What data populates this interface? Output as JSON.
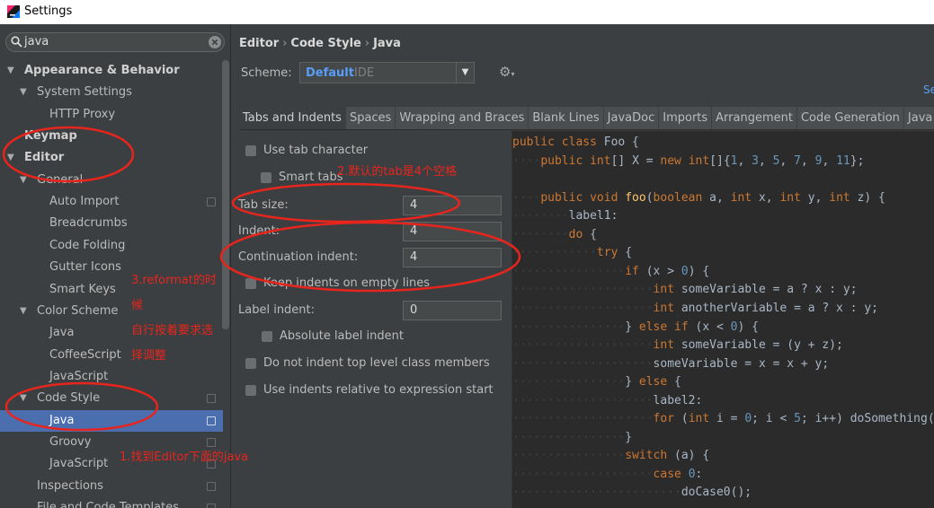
{
  "window": {
    "title": "Settings"
  },
  "search": {
    "value": "java"
  },
  "sidebar": {
    "items": [
      {
        "label": "Appearance & Behavior",
        "level": 0,
        "arrow": "▼",
        "bold": true,
        "selected": false,
        "page_icon": false
      },
      {
        "label": "System Settings",
        "level": 1,
        "arrow": "▼",
        "bold": false,
        "selected": false,
        "page_icon": false
      },
      {
        "label": "HTTP Proxy",
        "level": 2,
        "arrow": "",
        "bold": false,
        "selected": false,
        "page_icon": false
      },
      {
        "label": "Keymap",
        "level": 0,
        "arrow": "",
        "bold": true,
        "selected": false,
        "page_icon": false
      },
      {
        "label": "Editor",
        "level": 0,
        "arrow": "▼",
        "bold": true,
        "selected": false,
        "page_icon": false
      },
      {
        "label": "General",
        "level": 1,
        "arrow": "▼",
        "bold": false,
        "selected": false,
        "page_icon": false
      },
      {
        "label": "Auto Import",
        "level": 2,
        "arrow": "",
        "bold": false,
        "selected": false,
        "page_icon": true
      },
      {
        "label": "Breadcrumbs",
        "level": 2,
        "arrow": "",
        "bold": false,
        "selected": false,
        "page_icon": false
      },
      {
        "label": "Code Folding",
        "level": 2,
        "arrow": "",
        "bold": false,
        "selected": false,
        "page_icon": false
      },
      {
        "label": "Gutter Icons",
        "level": 2,
        "arrow": "",
        "bold": false,
        "selected": false,
        "page_icon": false
      },
      {
        "label": "Smart Keys",
        "level": 2,
        "arrow": "",
        "bold": false,
        "selected": false,
        "page_icon": false
      },
      {
        "label": "Color Scheme",
        "level": 1,
        "arrow": "▼",
        "bold": false,
        "selected": false,
        "page_icon": false
      },
      {
        "label": "Java",
        "level": 2,
        "arrow": "",
        "bold": false,
        "selected": false,
        "page_icon": false
      },
      {
        "label": "CoffeeScript",
        "level": 2,
        "arrow": "",
        "bold": false,
        "selected": false,
        "page_icon": false
      },
      {
        "label": "JavaScript",
        "level": 2,
        "arrow": "",
        "bold": false,
        "selected": false,
        "page_icon": false
      },
      {
        "label": "Code Style",
        "level": 1,
        "arrow": "▼",
        "bold": false,
        "selected": false,
        "page_icon": true
      },
      {
        "label": "Java",
        "level": 2,
        "arrow": "",
        "bold": false,
        "selected": true,
        "page_icon": true
      },
      {
        "label": "Groovy",
        "level": 2,
        "arrow": "",
        "bold": false,
        "selected": false,
        "page_icon": true
      },
      {
        "label": "JavaScript",
        "level": 2,
        "arrow": "",
        "bold": false,
        "selected": false,
        "page_icon": true
      },
      {
        "label": "Inspections",
        "level": 1,
        "arrow": "",
        "bold": false,
        "selected": false,
        "page_icon": true
      },
      {
        "label": "File and Code Templates",
        "level": 1,
        "arrow": "",
        "bold": false,
        "selected": false,
        "page_icon": true
      }
    ]
  },
  "breadcrumb": [
    "Editor",
    "Code Style",
    "Java"
  ],
  "scheme": {
    "label": "Scheme:",
    "value": "Default",
    "kind": "IDE",
    "set_from_link": "Se"
  },
  "tabs": [
    "Tabs and Indents",
    "Spaces",
    "Wrapping and Braces",
    "Blank Lines",
    "JavaDoc",
    "Imports",
    "Arrangement",
    "Code Generation",
    "Java EE Na"
  ],
  "active_tab": 0,
  "options": {
    "use_tab_character": "Use tab character",
    "smart_tabs": "Smart tabs",
    "tab_size_label": "Tab size:",
    "tab_size": "4",
    "indent_label": "Indent:",
    "indent": "4",
    "continuation_label": "Continuation indent:",
    "continuation": "4",
    "keep_indents": "Keep indents on empty lines",
    "label_indent_label": "Label indent:",
    "label_indent": "0",
    "absolute_label_indent": "Absolute label indent",
    "no_indent_top_level": "Do not indent top level class members",
    "use_relative_indents": "Use indents relative to expression start"
  },
  "code_lines": [
    {
      "indent": 0,
      "tokens": [
        [
          "kw",
          "public class "
        ],
        [
          "p",
          "Foo {"
        ]
      ]
    },
    {
      "indent": 1,
      "tokens": [
        [
          "kw",
          "public int"
        ],
        [
          "p",
          "[] X = "
        ],
        [
          "kw",
          "new int"
        ],
        [
          "p",
          "[]{"
        ],
        [
          "num",
          "1"
        ],
        [
          "p",
          ", "
        ],
        [
          "num",
          "3"
        ],
        [
          "p",
          ", "
        ],
        [
          "num",
          "5"
        ],
        [
          "p",
          ", "
        ],
        [
          "num",
          "7"
        ],
        [
          "p",
          ", "
        ],
        [
          "num",
          "9"
        ],
        [
          "p",
          ", "
        ],
        [
          "num",
          "11"
        ],
        [
          "p",
          "};"
        ]
      ]
    },
    {
      "indent": 0,
      "tokens": []
    },
    {
      "indent": 1,
      "tokens": [
        [
          "kw",
          "public void "
        ],
        [
          "fn",
          "foo"
        ],
        [
          "p",
          "("
        ],
        [
          "kw",
          "boolean "
        ],
        [
          "p",
          "a, "
        ],
        [
          "kw",
          "int "
        ],
        [
          "p",
          "x, "
        ],
        [
          "kw",
          "int "
        ],
        [
          "p",
          "y, "
        ],
        [
          "kw",
          "int "
        ],
        [
          "p",
          "z) {"
        ]
      ]
    },
    {
      "indent": 2,
      "tokens": [
        [
          "p",
          "label1:"
        ]
      ]
    },
    {
      "indent": 2,
      "tokens": [
        [
          "kw",
          "do "
        ],
        [
          "p",
          "{"
        ]
      ]
    },
    {
      "indent": 3,
      "tokens": [
        [
          "kw",
          "try "
        ],
        [
          "p",
          "{"
        ]
      ]
    },
    {
      "indent": 4,
      "tokens": [
        [
          "kw",
          "if "
        ],
        [
          "p",
          "(x > "
        ],
        [
          "num",
          "0"
        ],
        [
          "p",
          ") {"
        ]
      ]
    },
    {
      "indent": 5,
      "tokens": [
        [
          "kw",
          "int "
        ],
        [
          "p",
          "someVariable = a ? x : y;"
        ]
      ]
    },
    {
      "indent": 5,
      "tokens": [
        [
          "kw",
          "int "
        ],
        [
          "p",
          "anotherVariable = a ? x : y;"
        ]
      ]
    },
    {
      "indent": 4,
      "tokens": [
        [
          "p",
          "} "
        ],
        [
          "kw",
          "else if "
        ],
        [
          "p",
          "(x < "
        ],
        [
          "num",
          "0"
        ],
        [
          "p",
          ") {"
        ]
      ]
    },
    {
      "indent": 5,
      "tokens": [
        [
          "kw",
          "int "
        ],
        [
          "p",
          "someVariable = (y + z);"
        ]
      ]
    },
    {
      "indent": 5,
      "tokens": [
        [
          "p",
          "someVariable = x = x + y;"
        ]
      ]
    },
    {
      "indent": 4,
      "tokens": [
        [
          "p",
          "} "
        ],
        [
          "kw",
          "else "
        ],
        [
          "p",
          "{"
        ]
      ]
    },
    {
      "indent": 5,
      "tokens": [
        [
          "p",
          "label2:"
        ]
      ]
    },
    {
      "indent": 5,
      "tokens": [
        [
          "kw",
          "for "
        ],
        [
          "p",
          "("
        ],
        [
          "kw",
          "int "
        ],
        [
          "p",
          "i = "
        ],
        [
          "num",
          "0"
        ],
        [
          "p",
          "; i < "
        ],
        [
          "num",
          "5"
        ],
        [
          "p",
          "; i++) doSomething(i);"
        ]
      ]
    },
    {
      "indent": 4,
      "tokens": [
        [
          "p",
          "}"
        ]
      ]
    },
    {
      "indent": 4,
      "tokens": [
        [
          "kw",
          "switch "
        ],
        [
          "p",
          "(a) {"
        ]
      ]
    },
    {
      "indent": 5,
      "tokens": [
        [
          "kw",
          "case "
        ],
        [
          "num",
          "0"
        ],
        [
          "p",
          ":"
        ]
      ]
    },
    {
      "indent": 6,
      "tokens": [
        [
          "p",
          "doCase0();"
        ]
      ]
    }
  ],
  "annotations": {
    "note1": "1.找到Editor下面的java",
    "note2": "2.默认的tab是4个空格",
    "note3_line1": "3.reformat的时",
    "note3_line2": "候",
    "note3_line3": "自行按着要求选",
    "note3_line4": "择调整",
    "ink_color": "#e8251d"
  },
  "colors": {
    "background": "#3c3f41",
    "editor_bg": "#2b2b2b",
    "selection": "#4b6eaf",
    "link": "#589df6",
    "keyword": "#cc7832",
    "number": "#6897bb",
    "function": "#ffc66d"
  }
}
